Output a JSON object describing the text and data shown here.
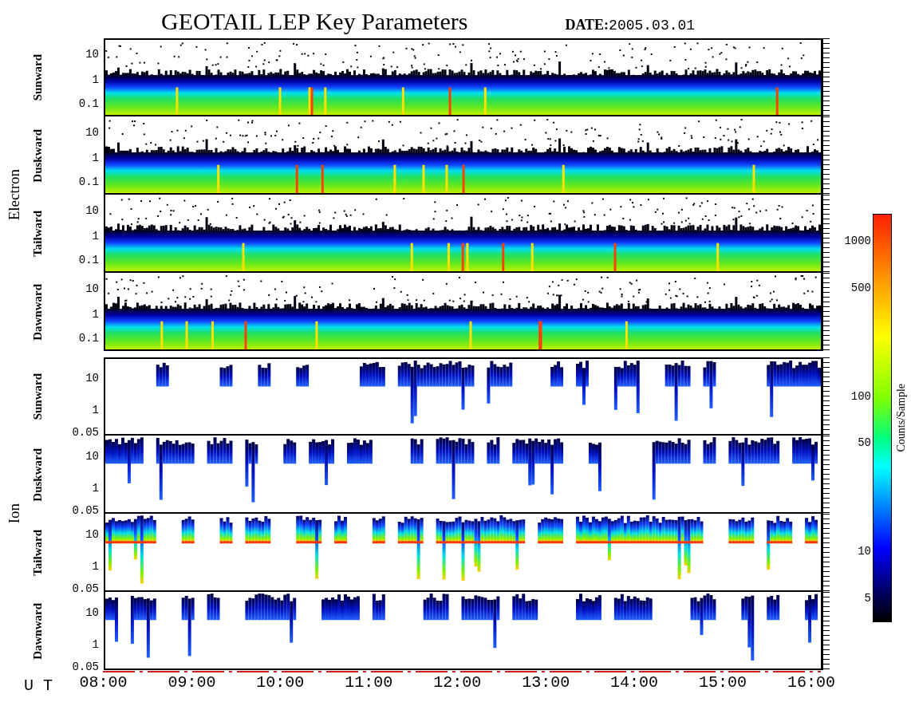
{
  "title": "GEOTAIL LEP Key Parameters",
  "date": {
    "label": "DATE:",
    "value": "2005.03.01"
  },
  "groups": [
    {
      "species": "Electron",
      "kind": "electron",
      "panels": [
        {
          "direction": "Sunward",
          "yticks": [
            "10",
            "1",
            "0.1"
          ]
        },
        {
          "direction": "Duskward",
          "yticks": [
            "10",
            "1",
            "0.1"
          ]
        },
        {
          "direction": "Tailward",
          "yticks": [
            "10",
            "1",
            "0.1"
          ]
        },
        {
          "direction": "Dawnward",
          "yticks": [
            "10",
            "1",
            "0.1"
          ]
        }
      ]
    },
    {
      "species": "Ion",
      "kind": "ion",
      "panels": [
        {
          "direction": "Sunward",
          "yticks": [
            "10",
            "1",
            "0.05"
          ]
        },
        {
          "direction": "Duskward",
          "yticks": [
            "10",
            "1",
            "0.05"
          ]
        },
        {
          "direction": "Tailward",
          "yticks": [
            "10",
            "1",
            "0.05"
          ]
        },
        {
          "direction": "Dawnward",
          "yticks": [
            "10",
            "1",
            "0.05"
          ]
        }
      ]
    }
  ],
  "colorbar": {
    "label": "Counts/Sample",
    "ticks": [
      "1000",
      "500",
      "100",
      "50",
      "10",
      "5"
    ]
  },
  "time_axis": {
    "label": "U T",
    "ticks": [
      "08:00",
      "09:00",
      "10:00",
      "11:00",
      "12:00",
      "13:00",
      "14:00",
      "15:00",
      "16:00"
    ]
  }
}
